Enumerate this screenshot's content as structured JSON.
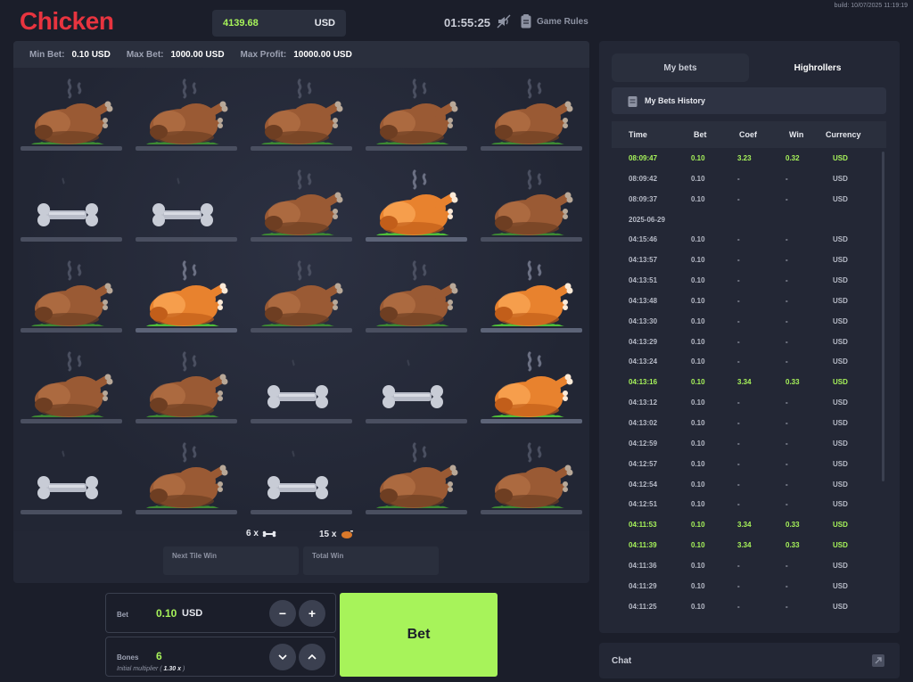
{
  "header": {
    "logo": "Chicken",
    "balance": "4139.68",
    "balance_currency": "USD",
    "timer": "01:55:25",
    "game_rules": "Game Rules",
    "build": "build: 10/07/2025 11:19:19"
  },
  "limits": {
    "min_label": "Min Bet:",
    "min_value": "0.10 USD",
    "max_label": "Max Bet:",
    "max_value": "1000.00 USD",
    "profit_label": "Max Profit:",
    "profit_value": "10000.00 USD"
  },
  "board": {
    "rows": [
      [
        "chicken-dim",
        "chicken-dim",
        "chicken-dim",
        "chicken-dim",
        "chicken-dim"
      ],
      [
        "bone",
        "bone",
        "chicken-dim",
        "chicken-bright",
        "chicken-dim"
      ],
      [
        "chicken-dim",
        "chicken-bright",
        "chicken-dim",
        "chicken-dim",
        "chicken-bright"
      ],
      [
        "chicken-dim",
        "chicken-dim",
        "bone",
        "bone",
        "chicken-bright"
      ],
      [
        "bone",
        "chicken-dim",
        "bone",
        "chicken-dim",
        "chicken-dim"
      ]
    ]
  },
  "counts": {
    "bones": "6 x",
    "chickens": "15 x"
  },
  "win": {
    "next_tile": "Next Tile Win",
    "total": "Total Win"
  },
  "controls": {
    "bet_label": "Bet",
    "bet_value": "0.10",
    "bet_currency": "USD",
    "minus": "−",
    "plus": "+",
    "bones_label": "Bones",
    "bones_value": "6",
    "multiplier_prefix": "Initial multiplier (",
    "multiplier_value": "1.30 x",
    "multiplier_suffix": ")",
    "bet_button": "Bet"
  },
  "side": {
    "tab_my_bets": "My bets",
    "tab_highrollers": "Highrollers",
    "history_title": "My Bets History",
    "columns": [
      "Time",
      "Bet",
      "Coef",
      "Win",
      "Currency"
    ],
    "rows": [
      {
        "time": "08:09:47",
        "bet": "0.10",
        "coef": "3.23",
        "win": "0.32",
        "cur": "USD",
        "hi": true
      },
      {
        "time": "08:09:42",
        "bet": "0.10",
        "coef": "-",
        "win": "-",
        "cur": "USD"
      },
      {
        "time": "08:09:37",
        "bet": "0.10",
        "coef": "-",
        "win": "-",
        "cur": "USD"
      },
      {
        "time": "2025-06-29",
        "bet": "",
        "coef": "",
        "win": "",
        "cur": "",
        "date": true
      },
      {
        "time": "04:15:46",
        "bet": "0.10",
        "coef": "-",
        "win": "-",
        "cur": "USD"
      },
      {
        "time": "04:13:57",
        "bet": "0.10",
        "coef": "-",
        "win": "-",
        "cur": "USD"
      },
      {
        "time": "04:13:51",
        "bet": "0.10",
        "coef": "-",
        "win": "-",
        "cur": "USD"
      },
      {
        "time": "04:13:48",
        "bet": "0.10",
        "coef": "-",
        "win": "-",
        "cur": "USD"
      },
      {
        "time": "04:13:30",
        "bet": "0.10",
        "coef": "-",
        "win": "-",
        "cur": "USD"
      },
      {
        "time": "04:13:29",
        "bet": "0.10",
        "coef": "-",
        "win": "-",
        "cur": "USD"
      },
      {
        "time": "04:13:24",
        "bet": "0.10",
        "coef": "-",
        "win": "-",
        "cur": "USD"
      },
      {
        "time": "04:13:16",
        "bet": "0.10",
        "coef": "3.34",
        "win": "0.33",
        "cur": "USD",
        "hi": true
      },
      {
        "time": "04:13:12",
        "bet": "0.10",
        "coef": "-",
        "win": "-",
        "cur": "USD"
      },
      {
        "time": "04:13:02",
        "bet": "0.10",
        "coef": "-",
        "win": "-",
        "cur": "USD"
      },
      {
        "time": "04:12:59",
        "bet": "0.10",
        "coef": "-",
        "win": "-",
        "cur": "USD"
      },
      {
        "time": "04:12:57",
        "bet": "0.10",
        "coef": "-",
        "win": "-",
        "cur": "USD"
      },
      {
        "time": "04:12:54",
        "bet": "0.10",
        "coef": "-",
        "win": "-",
        "cur": "USD"
      },
      {
        "time": "04:12:51",
        "bet": "0.10",
        "coef": "-",
        "win": "-",
        "cur": "USD"
      },
      {
        "time": "04:11:53",
        "bet": "0.10",
        "coef": "3.34",
        "win": "0.33",
        "cur": "USD",
        "hi": true
      },
      {
        "time": "04:11:39",
        "bet": "0.10",
        "coef": "3.34",
        "win": "0.33",
        "cur": "USD",
        "hi": true
      },
      {
        "time": "04:11:36",
        "bet": "0.10",
        "coef": "-",
        "win": "-",
        "cur": "USD"
      },
      {
        "time": "04:11:29",
        "bet": "0.10",
        "coef": "-",
        "win": "-",
        "cur": "USD"
      },
      {
        "time": "04:11:25",
        "bet": "0.10",
        "coef": "-",
        "win": "-",
        "cur": "USD"
      }
    ]
  },
  "chat": {
    "label": "Chat"
  },
  "colors": {
    "accent": "#a7f35a",
    "brand": "#e8343f",
    "panel": "#232735",
    "bg": "#1b1e2a"
  }
}
